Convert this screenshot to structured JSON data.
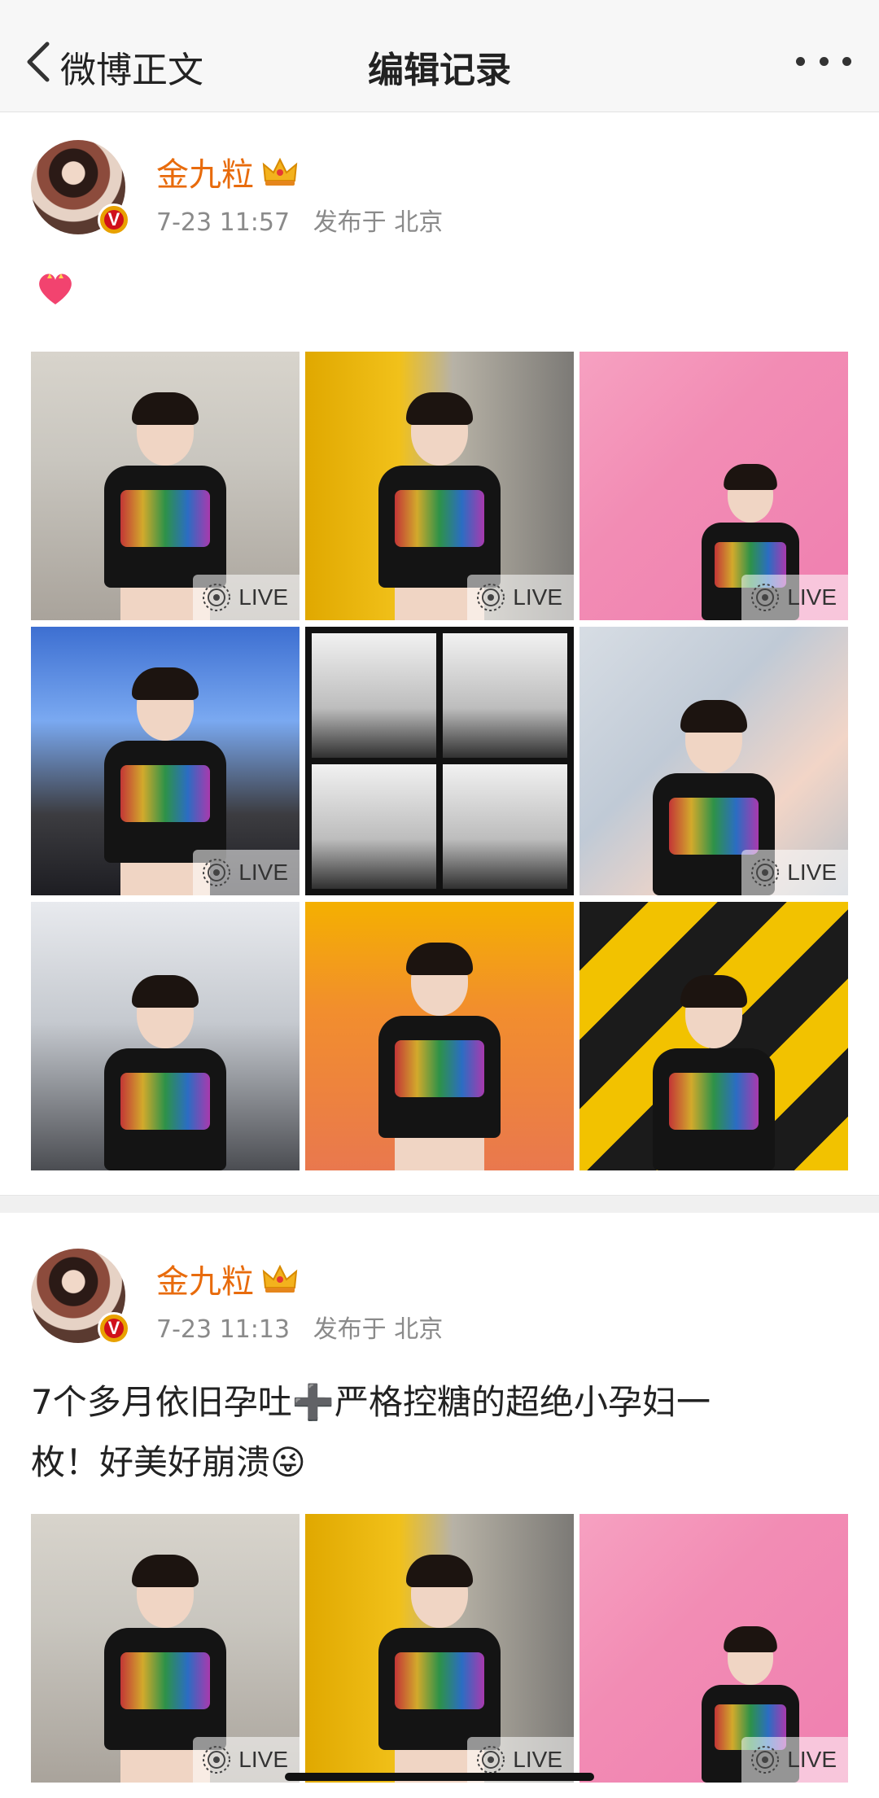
{
  "nav": {
    "back_label": "微博正文",
    "title": "编辑记录"
  },
  "posts": [
    {
      "username": "金九粒",
      "time": "7-23 11:57",
      "published": "发布于 北京",
      "text": "",
      "emoji": "heart-emoji",
      "images": [
        {
          "live": "LIVE"
        },
        {
          "live": "LIVE"
        },
        {
          "live": "LIVE"
        },
        {
          "live": "LIVE"
        },
        {
          "live": ""
        },
        {
          "live": "LIVE"
        },
        {
          "live": ""
        },
        {
          "live": ""
        },
        {
          "live": ""
        }
      ]
    },
    {
      "username": "金九粒",
      "time": "7-23 11:13",
      "published": "发布于 北京",
      "text_line1": "7个多月依旧孕吐➕严格控糖的超绝小孕妇一",
      "text_line2": "枚！好美好崩溃😜",
      "images": [
        {
          "live": "LIVE"
        },
        {
          "live": "LIVE"
        },
        {
          "live": "LIVE"
        }
      ]
    }
  ],
  "colors": {
    "username": "#e86b0c",
    "meta": "#8a8a8a",
    "nav_bg": "#f7f7f7"
  }
}
